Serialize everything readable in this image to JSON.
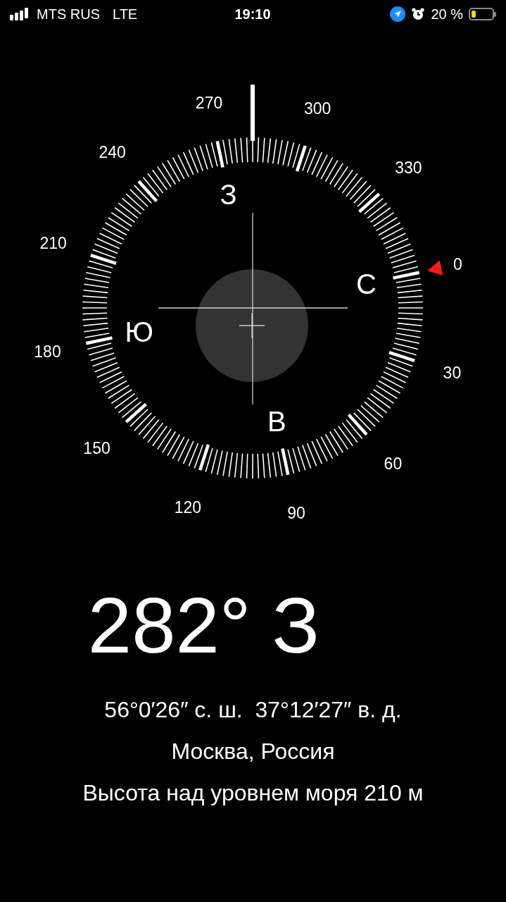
{
  "status_bar": {
    "carrier": "MTS RUS",
    "network": "LTE",
    "time": "19:10",
    "battery_percent": "20 %",
    "battery": {
      "level": 0.2
    }
  },
  "compass": {
    "degree_labels": [
      "0",
      "30",
      "60",
      "90",
      "120",
      "150",
      "180",
      "210",
      "240",
      "270",
      "300",
      "330"
    ],
    "cardinal_labels": [
      "С",
      "В",
      "Ю",
      "З"
    ]
  },
  "heading": {
    "degrees": "282°",
    "direction": "З"
  },
  "location": {
    "coordinates": "56°0′26″ с. ш.  37°12′27″ в. д.",
    "place": "Москва, Россия",
    "altitude": "Высота над уровнем моря 210 м"
  }
}
